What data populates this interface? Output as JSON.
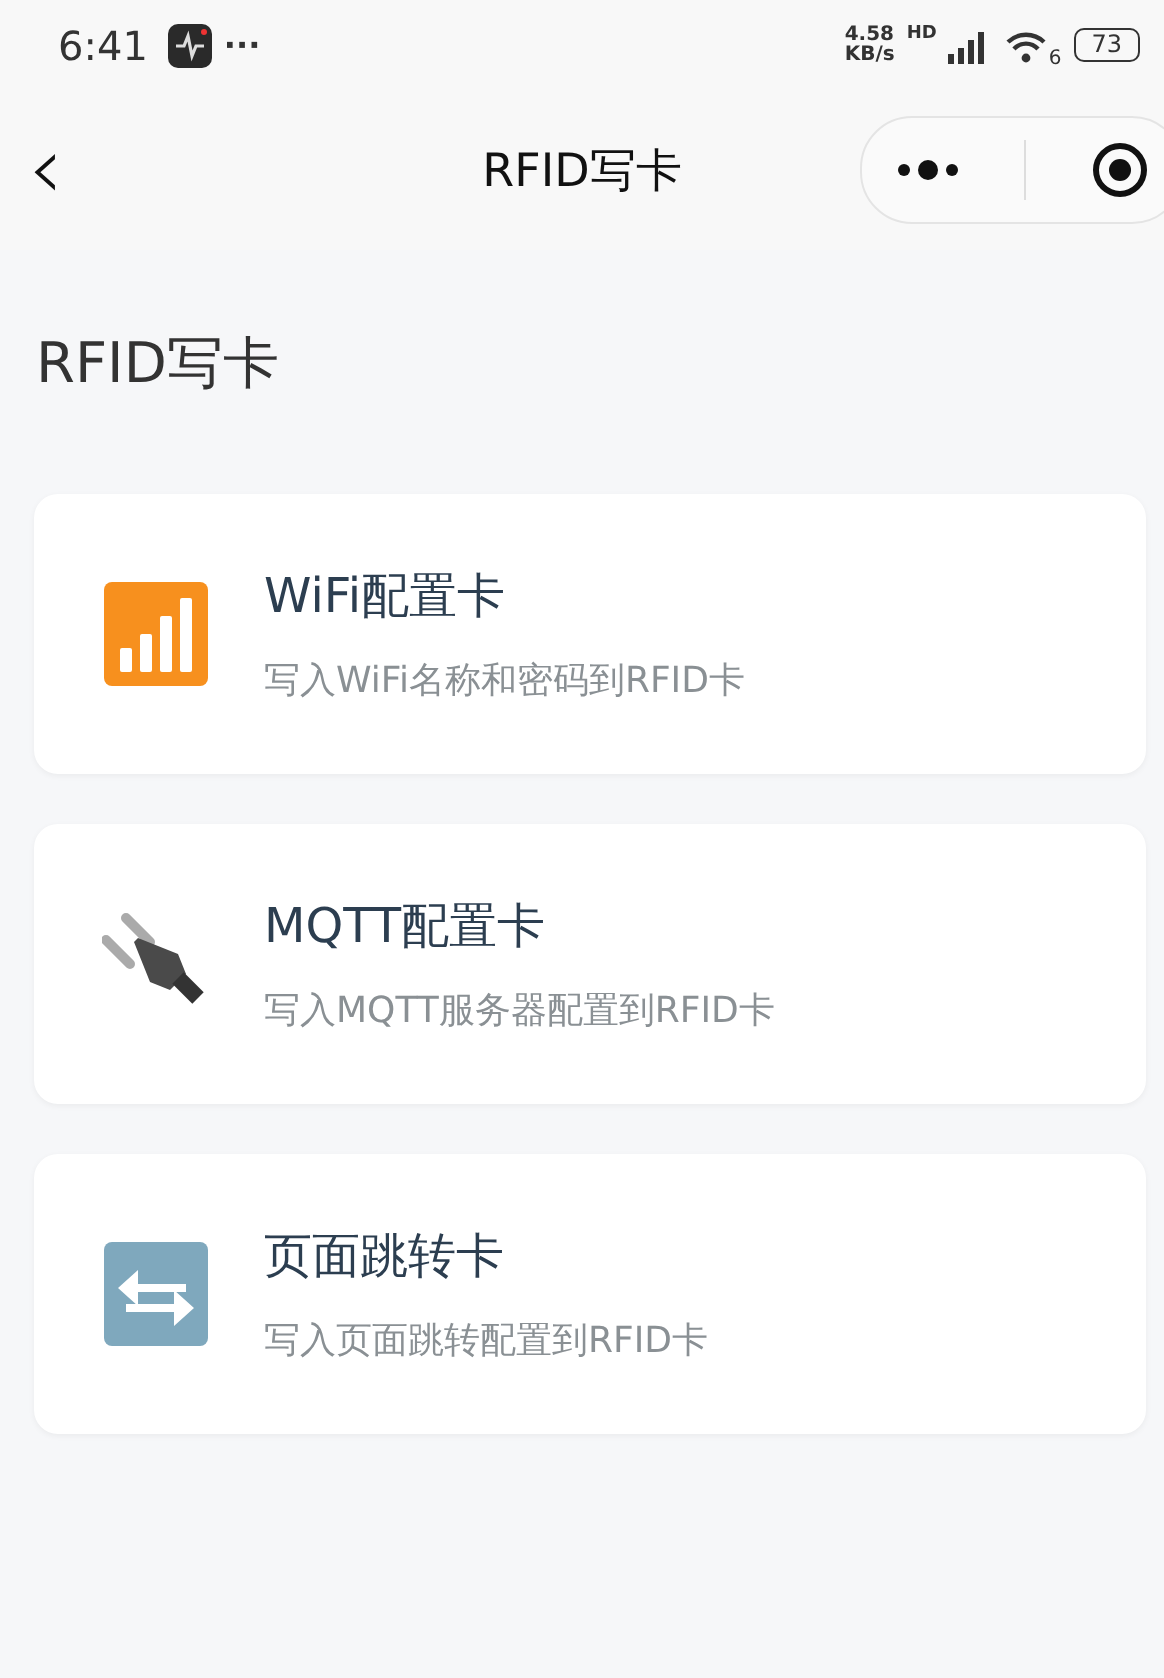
{
  "status_bar": {
    "time": "6:41",
    "dots": "···",
    "speed_value": "4.58",
    "speed_unit": "KB/s",
    "network": "HD",
    "wifi_gen": "6",
    "battery": "73"
  },
  "nav_bar": {
    "back": "‹",
    "title": "RFID写卡"
  },
  "page_title": "RFID写卡",
  "cards": [
    {
      "kind": "signal",
      "title": "WiFi配置卡",
      "subtitle": "写入WiFi名称和密码到RFID卡"
    },
    {
      "kind": "plug",
      "title": "MQTT配置卡",
      "subtitle": "写入MQTT服务器配置到RFID卡"
    },
    {
      "kind": "arrows",
      "title": "页面跳转卡",
      "subtitle": "写入页面跳转配置到RFID卡"
    }
  ]
}
